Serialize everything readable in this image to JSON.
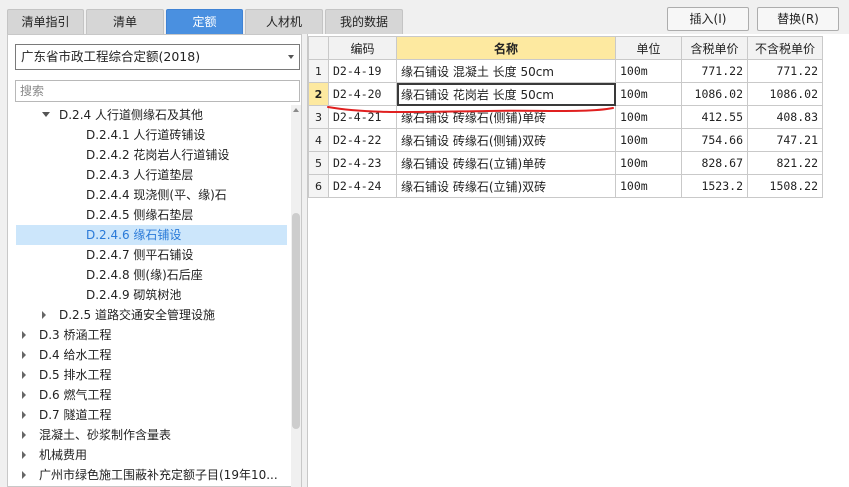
{
  "tabs": [
    {
      "label": "清单指引",
      "active": false
    },
    {
      "label": "清单",
      "active": false
    },
    {
      "label": "定额",
      "active": true
    },
    {
      "label": "人材机",
      "active": false
    },
    {
      "label": "我的数据",
      "active": false
    }
  ],
  "toolbar": {
    "insert_label": "插入(I)",
    "replace_label": "替换(R)"
  },
  "left": {
    "library_selected": "广东省市政工程综合定额(2018)",
    "search_placeholder": "搜索",
    "tree": [
      {
        "label": "D.2.4 人行道侧缘石及其他",
        "expander": "down",
        "selected": false
      },
      {
        "label": "D.2.4.1 人行道砖铺设",
        "expander": "none",
        "selected": false
      },
      {
        "label": "D.2.4.2 花岗岩人行道铺设",
        "expander": "none",
        "selected": false
      },
      {
        "label": "D.2.4.3 人行道垫层",
        "expander": "none",
        "selected": false
      },
      {
        "label": "D.2.4.4 现浇侧(平、缘)石",
        "expander": "none",
        "selected": false
      },
      {
        "label": "D.2.4.5 侧缘石垫层",
        "expander": "none",
        "selected": false
      },
      {
        "label": "D.2.4.6 缘石铺设",
        "expander": "none",
        "selected": true
      },
      {
        "label": "D.2.4.7 侧平石铺设",
        "expander": "none",
        "selected": false
      },
      {
        "label": "D.2.4.8 侧(缘)石后座",
        "expander": "none",
        "selected": false
      },
      {
        "label": "D.2.4.9 砌筑树池",
        "expander": "none",
        "selected": false
      },
      {
        "label": "D.2.5 道路交通安全管理设施",
        "expander": "right",
        "selected": false
      },
      {
        "label": "D.3 桥涵工程",
        "expander": "right",
        "selected": false
      },
      {
        "label": "D.4 给水工程",
        "expander": "right",
        "selected": false
      },
      {
        "label": "D.5 排水工程",
        "expander": "right",
        "selected": false
      },
      {
        "label": "D.6 燃气工程",
        "expander": "right",
        "selected": false
      },
      {
        "label": "D.7 隧道工程",
        "expander": "right",
        "selected": false
      },
      {
        "label": "混凝土、砂浆制作含量表",
        "expander": "right",
        "selected": false
      },
      {
        "label": "机械费用",
        "expander": "right",
        "selected": false
      },
      {
        "label": "广州市绿色施工围蔽补充定额子目(19年10...",
        "expander": "right",
        "selected": false
      }
    ]
  },
  "grid": {
    "columns": [
      "",
      "编码",
      "名称",
      "单位",
      "含税单价",
      "不含税单价"
    ],
    "rows": [
      {
        "num": "1",
        "code": "D2-4-19",
        "name": "缘石铺设 混凝土 长度 50cm",
        "unit": "100m",
        "price_tax": "771.22",
        "price_notax": "771.22"
      },
      {
        "num": "2",
        "code": "D2-4-20",
        "name": "缘石铺设 花岗岩 长度 50cm",
        "unit": "100m",
        "price_tax": "1086.02",
        "price_notax": "1086.02"
      },
      {
        "num": "3",
        "code": "D2-4-21",
        "name": "缘石铺设 砖缘石(侧铺)单砖",
        "unit": "100m",
        "price_tax": "412.55",
        "price_notax": "408.83"
      },
      {
        "num": "4",
        "code": "D2-4-22",
        "name": "缘石铺设 砖缘石(侧铺)双砖",
        "unit": "100m",
        "price_tax": "754.66",
        "price_notax": "747.21"
      },
      {
        "num": "5",
        "code": "D2-4-23",
        "name": "缘石铺设 砖缘石(立铺)单砖",
        "unit": "100m",
        "price_tax": "828.67",
        "price_notax": "821.22"
      },
      {
        "num": "6",
        "code": "D2-4-24",
        "name": "缘石铺设 砖缘石(立铺)双砖",
        "unit": "100m",
        "price_tax": "1523.2",
        "price_notax": "1508.22"
      }
    ],
    "selected_row": 1
  },
  "colors": {
    "accent": "#4a90e0",
    "selected_bg": "#cce6fb",
    "selected_text": "#2a7ad8",
    "header_highlight": "#fde9a0",
    "annotation": "#e02020"
  }
}
